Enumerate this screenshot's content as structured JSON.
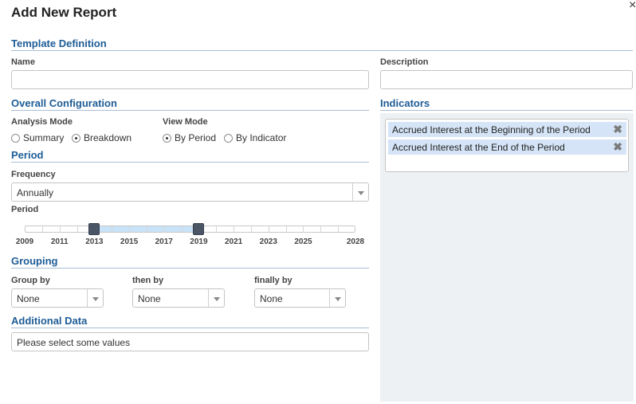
{
  "dialog": {
    "title": "Add New Report",
    "close_glyph": "×"
  },
  "template_definition": {
    "heading": "Template Definition",
    "name_label": "Name",
    "name_value": "",
    "description_label": "Description",
    "description_value": ""
  },
  "overall_configuration": {
    "heading": "Overall Configuration",
    "analysis_mode": {
      "label": "Analysis Mode",
      "options": [
        {
          "label": "Summary",
          "selected": false
        },
        {
          "label": "Breakdown",
          "selected": true
        }
      ]
    },
    "view_mode": {
      "label": "View Mode",
      "options": [
        {
          "label": "By Period",
          "selected": true
        },
        {
          "label": "By Indicator",
          "selected": false
        }
      ]
    }
  },
  "period": {
    "heading": "Period",
    "frequency_label": "Frequency",
    "frequency_value": "Annually",
    "period_label": "Period",
    "slider": {
      "min": 2009,
      "max": 2028,
      "selected_start": 2013,
      "selected_end": 2019,
      "tick_labels": [
        "2009",
        "2011",
        "2013",
        "2015",
        "2017",
        "2019",
        "2021",
        "2023",
        "2025",
        "2028"
      ],
      "accent": "#c8e2f7"
    }
  },
  "grouping": {
    "heading": "Grouping",
    "group_by": {
      "label": "Group by",
      "value": "None"
    },
    "then_by": {
      "label": "then by",
      "value": "None"
    },
    "finally_by": {
      "label": "finally by",
      "value": "None"
    }
  },
  "additional_data": {
    "heading": "Additional Data",
    "placeholder": "Please select some values"
  },
  "indicators": {
    "heading": "Indicators",
    "selected": [
      "Accrued Interest at the Beginning of the Period",
      "Accrued Interest at the End of the Period"
    ],
    "remove_glyph": "✖"
  },
  "colors": {
    "section_heading": "#1d5c96",
    "chip_background": "#d5e5f7",
    "panel_background": "#eef1f3"
  }
}
